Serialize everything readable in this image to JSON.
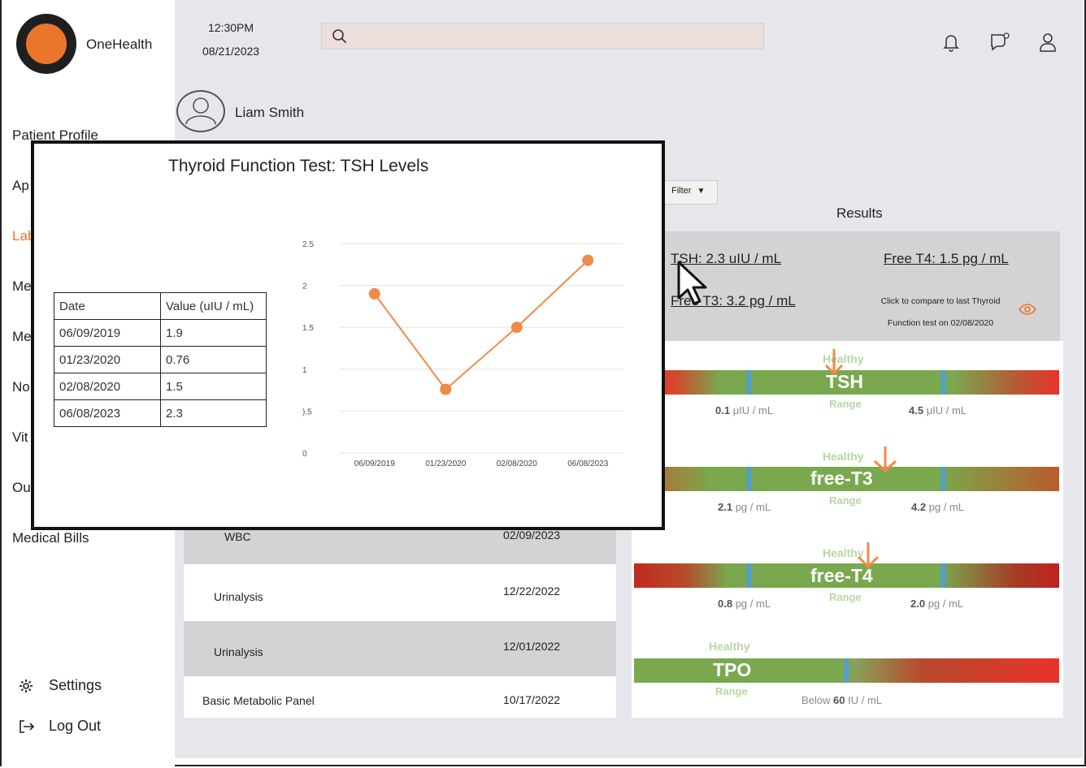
{
  "app": {
    "brand": "OneHealth"
  },
  "header": {
    "time": "12:30PM",
    "date": "08/21/2023",
    "search_placeholder": ""
  },
  "patient": {
    "name": "Liam Smith"
  },
  "sidebar": {
    "items": [
      {
        "label": "Patient Profile"
      },
      {
        "label": "Ap"
      },
      {
        "label": "Lab"
      },
      {
        "label": "Me"
      },
      {
        "label": "Me"
      },
      {
        "label": "No"
      },
      {
        "label": "Vit"
      },
      {
        "label": "Ou"
      },
      {
        "label": "Medical Bills"
      }
    ],
    "settings": "Settings",
    "logout": "Log Out"
  },
  "filter": {
    "label": "Filter"
  },
  "results": {
    "title": "Results",
    "tsh": "TSH: 2.3 uIU / mL",
    "free_t4": "Free T4: 1.5 pg / mL",
    "free_t3": "Free T3: 3.2 pg / mL",
    "compare": "Click to compare to last Thyroid Function test on 02/08/2020"
  },
  "gauges": [
    {
      "name": "TSH",
      "healthy": "Healthy",
      "range": "Range",
      "low_num": "0.1",
      "low_unit": " μIU / mL",
      "high_num": "4.5",
      "high_unit": " μIU / mL",
      "level": 0.47
    },
    {
      "name": "free-T3",
      "healthy": "Healthy",
      "range": "Range",
      "low_num": "2.1",
      "low_unit": " pg / mL",
      "high_num": "4.2",
      "high_unit": " pg / mL",
      "level": 0.59
    },
    {
      "name": "free-T4",
      "healthy": "Healthy",
      "range": "Range",
      "low_num": "0.8",
      "low_unit": " pg / mL",
      "high_num": "2.0",
      "high_unit": " pg / mL",
      "level": 0.55
    },
    {
      "name": "TPO",
      "healthy": "Healthy",
      "range": "Range",
      "below": "Below ",
      "high_num": "60",
      "high_unit": " IU / mL"
    }
  ],
  "lab_list": [
    {
      "name": "WBC",
      "date": "02/09/2023"
    },
    {
      "name": "Urinalysis",
      "date": "12/22/2022"
    },
    {
      "name": "Urinalysis",
      "date": "12/01/2022"
    },
    {
      "name": "Basic Metabolic Panel",
      "date": "10/17/2022"
    }
  ],
  "popup": {
    "title": "Thyroid Function Test: TSH Levels",
    "table_headers": [
      "Date",
      "Value (uIU / mL)"
    ],
    "table_rows": [
      [
        "06/09/2019",
        "1.9"
      ],
      [
        "01/23/2020",
        "0.76"
      ],
      [
        "02/08/2020",
        "1.5"
      ],
      [
        "06/08/2023",
        "2.3"
      ]
    ]
  },
  "chart_data": {
    "type": "line",
    "title": "",
    "categories": [
      "06/09/2019",
      "01/23/2020",
      "02/08/2020",
      "06/08/2023"
    ],
    "series": [
      {
        "values": [
          1.9,
          0.76,
          1.5,
          2.3
        ],
        "color": "#ef8a47"
      }
    ],
    "ylim": [
      0,
      2.5
    ],
    "y_ticks": [
      "0",
      "0.5",
      "1",
      "1.5",
      "2",
      "2.5"
    ],
    "y_tick_labels_visible": [
      "0",
      ").5",
      "1",
      "1.5",
      "2",
      "2.5"
    ],
    "grid": true
  },
  "colors": {
    "accent": "#e9762b",
    "healthy_green": "#79a84f",
    "alert_red": "#e8332a",
    "tick_blue": "#4a9fdc"
  }
}
